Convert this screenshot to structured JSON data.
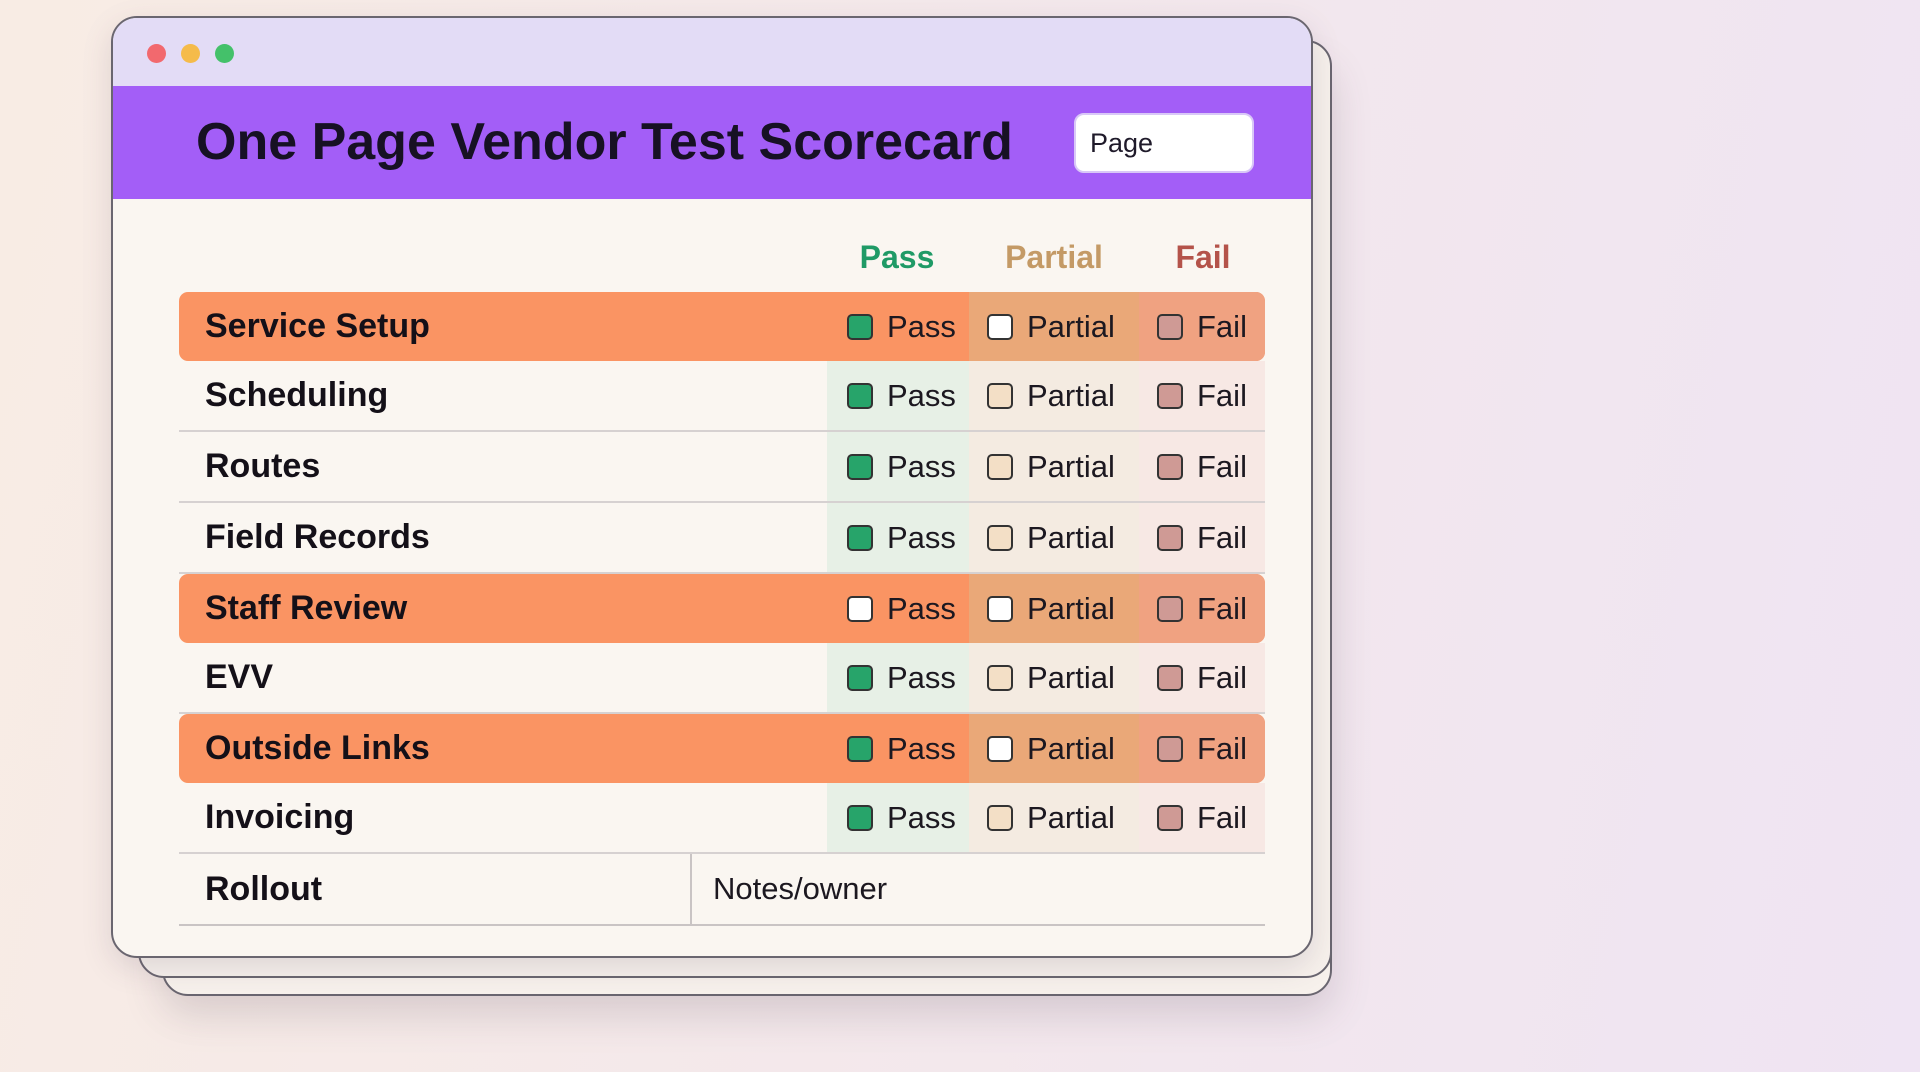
{
  "colors": {
    "page_bg_start": "#f8ece4",
    "page_bg_end": "#efe4f3",
    "titlebar": "#e3dcf6",
    "header": "#a35ef7",
    "highlight_row": "#fa9463",
    "pass_header": "#1f9a66",
    "partial_header": "#c49a66",
    "fail_header": "#b4534a",
    "pass_column_bg": "#e7f0e6",
    "partial_column_bg": "#f4ebe1",
    "fail_column_bg": "#f7e8e4",
    "highlight_partial_bg": "#eaa878",
    "highlight_fail_bg": "#f0a281",
    "checked_pass": "#27a46a",
    "unchecked_pass": "#ffffff",
    "partial_box_fill": "#f3dfc6",
    "fail_box_fill": "#cf9a95",
    "dot_red": "#f2696e",
    "dot_yellow": "#f5bb4a",
    "dot_green": "#44c16a"
  },
  "window": {
    "controls": [
      "close-dot",
      "minimize-dot",
      "maximize-dot"
    ]
  },
  "header": {
    "title": "One Page Vendor Test Scorecard",
    "page_field_value": "Page"
  },
  "columns": {
    "pass": "Pass",
    "partial": "Partial",
    "fail": "Fail"
  },
  "rows": [
    {
      "label": "Service Setup",
      "highlight": true,
      "pass_checked": true,
      "pass": "Pass",
      "partial": "Partial",
      "fail": "Fail"
    },
    {
      "label": "Scheduling",
      "highlight": false,
      "pass_checked": true,
      "pass": "Pass",
      "partial": "Partial",
      "fail": "Fail"
    },
    {
      "label": "Routes",
      "highlight": false,
      "pass_checked": true,
      "pass": "Pass",
      "partial": "Partial",
      "fail": "Fail"
    },
    {
      "label": "Field Records",
      "highlight": false,
      "pass_checked": true,
      "pass": "Pass",
      "partial": "Partial",
      "fail": "Fail"
    },
    {
      "label": "Staff Review",
      "highlight": true,
      "pass_checked": false,
      "pass": "Pass",
      "partial": "Partial",
      "fail": "Fail"
    },
    {
      "label": "EVV",
      "highlight": false,
      "pass_checked": true,
      "pass": "Pass",
      "partial": "Partial",
      "fail": "Fail"
    },
    {
      "label": "Outside Links",
      "highlight": true,
      "pass_checked": true,
      "pass": "Pass",
      "partial": "Partial",
      "fail": "Fail"
    },
    {
      "label": "Invoicing",
      "highlight": false,
      "pass_checked": true,
      "pass": "Pass",
      "partial": "Partial",
      "fail": "Fail"
    }
  ],
  "rollout": {
    "label": "Rollout",
    "notes": "Notes/owner"
  }
}
